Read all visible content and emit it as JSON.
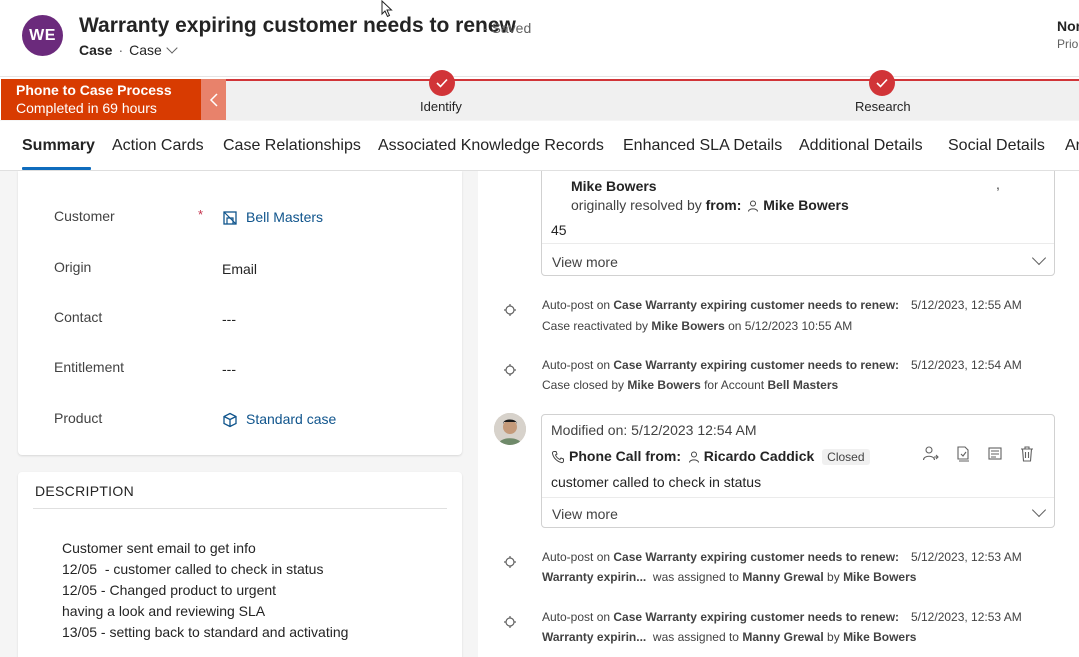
{
  "header": {
    "avatar_initials": "WE",
    "title": "Warranty expiring customer needs to renew",
    "save_status": "- Saved",
    "entity": "Case",
    "form_selector": "Case",
    "right_value": "Nor",
    "right_label": "Prio"
  },
  "process": {
    "active_stage_name": "Phone to Case Process",
    "active_stage_sub": "Completed in 69 hours",
    "stages": [
      {
        "label": "Identify"
      },
      {
        "label": "Research"
      }
    ]
  },
  "tabs": [
    "Summary",
    "Action Cards",
    "Case Relationships",
    "Associated Knowledge Records",
    "Enhanced SLA Details",
    "Additional Details",
    "Social Details",
    "Ar"
  ],
  "form": {
    "customer_label": "Customer",
    "customer_required": "*",
    "customer_value": "Bell Masters",
    "origin_label": "Origin",
    "origin_value": "Email",
    "contact_label": "Contact",
    "contact_value": "---",
    "entitlement_label": "Entitlement",
    "entitlement_value": "---",
    "product_label": "Product",
    "product_value": "Standard case"
  },
  "description": {
    "title": "DESCRIPTION",
    "lines": [
      "Customer sent email to get info",
      "12/05  - customer called to check in status",
      "12/05 - Changed product to urgent",
      "having a look and reviewing SLA",
      "13/05 - setting back to standard and activating"
    ]
  },
  "timeline": {
    "card1": {
      "name": "Mike Bowers",
      "comma": ",",
      "resolved_prefix": "originally resolved by",
      "resolved_from": "from:",
      "resolved_by": "Mike Bowers",
      "value": "45",
      "view_more": "View more"
    },
    "post1": {
      "prefix": "Auto-post on",
      "subject": "Case Warranty expiring customer needs to renew:",
      "time": "5/12/2023, 12:55 AM",
      "line2_a": "Case reactivated by",
      "line2_user": "Mike Bowers",
      "line2_b": "on 5/12/2023 10:55 AM"
    },
    "post2": {
      "prefix": "Auto-post on",
      "subject": "Case Warranty expiring customer needs to renew:",
      "time": "5/12/2023, 12:54 AM",
      "line2_a": "Case closed by",
      "line2_user": "Mike Bowers",
      "line2_b": "for Account",
      "line2_account": "Bell Masters"
    },
    "card2": {
      "modified": "Modified on: 5/12/2023 12:54 AM",
      "activity": "Phone Call from:",
      "from_user": "Ricardo Caddick",
      "status": "Closed",
      "body": "customer called to check in status",
      "view_more": "View more"
    },
    "post3": {
      "prefix": "Auto-post on",
      "subject": "Case Warranty expiring customer needs to renew:",
      "time": "5/12/2023, 12:53 AM",
      "line2_a": "Warranty expirin...",
      "line2_b": "was assigned to",
      "line2_user": "Manny Grewal",
      "line2_c": "by",
      "line2_by": "Mike Bowers"
    },
    "post4": {
      "prefix": "Auto-post on",
      "subject": "Case Warranty expiring customer needs to renew:",
      "time": "5/12/2023, 12:53 AM",
      "line2_a": "Warranty expirin...",
      "line2_b": "was assigned to",
      "line2_user": "Manny Grewal",
      "line2_c": "by",
      "line2_by": "Mike Bowers"
    }
  },
  "colors": {
    "accent": "#0f6cbd",
    "process_active": "#d83b01",
    "process_track": "#d13438",
    "avatar": "#6b2a7c",
    "link": "#0f548c"
  }
}
